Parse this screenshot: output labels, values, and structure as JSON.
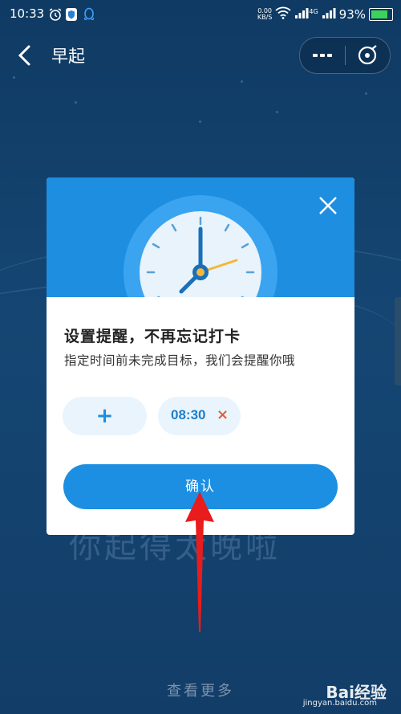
{
  "status_bar": {
    "time": "10:33",
    "net_speed_value": "0.00",
    "net_speed_unit": "KB/S",
    "signal_label": "4G",
    "battery": "93%",
    "battery_level": 0.93
  },
  "header": {
    "title": "早起"
  },
  "background": {
    "promo_text": "你起得太晚啦",
    "see_more": "查看更多"
  },
  "modal": {
    "title": "设置提醒，不再忘记打卡",
    "subtitle": "指定时间前未完成目标，我们会提醒你哦",
    "add_label": "+",
    "time_value": "08:30",
    "remove_label": "×",
    "confirm_label": "确认"
  },
  "watermark": {
    "brand": "Bai经验",
    "site": "jingyan.baidu.com"
  },
  "colors": {
    "accent": "#1e8ee0",
    "background": "#143d66",
    "annotation_arrow": "#e81c1c",
    "remove": "#e0603a"
  }
}
